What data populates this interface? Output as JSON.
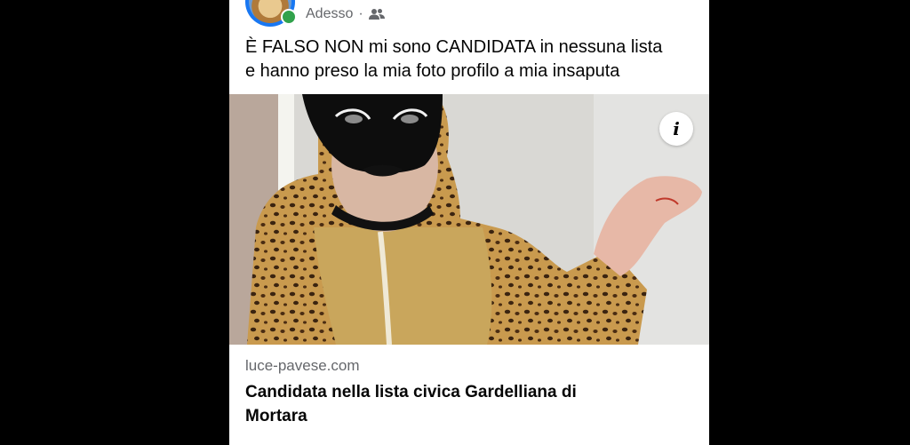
{
  "post": {
    "timestamp": "Adesso",
    "separator": "·",
    "audience_icon": "friends-icon",
    "text_line1": "È FALSO NON mi sono CANDIDATA in nessuna lista",
    "text_line2": "e hanno preso la mia foto profilo a mia insaputa"
  },
  "image": {
    "info_label": "i"
  },
  "link_preview": {
    "domain": "luce-pavese.com",
    "headline_line1": "Candidata nella lista civica Gardelliana di",
    "headline_line2": "Mortara"
  },
  "colors": {
    "background": "#000000",
    "card": "#ffffff",
    "online": "#31a24c",
    "secondary_text": "#65676b"
  }
}
